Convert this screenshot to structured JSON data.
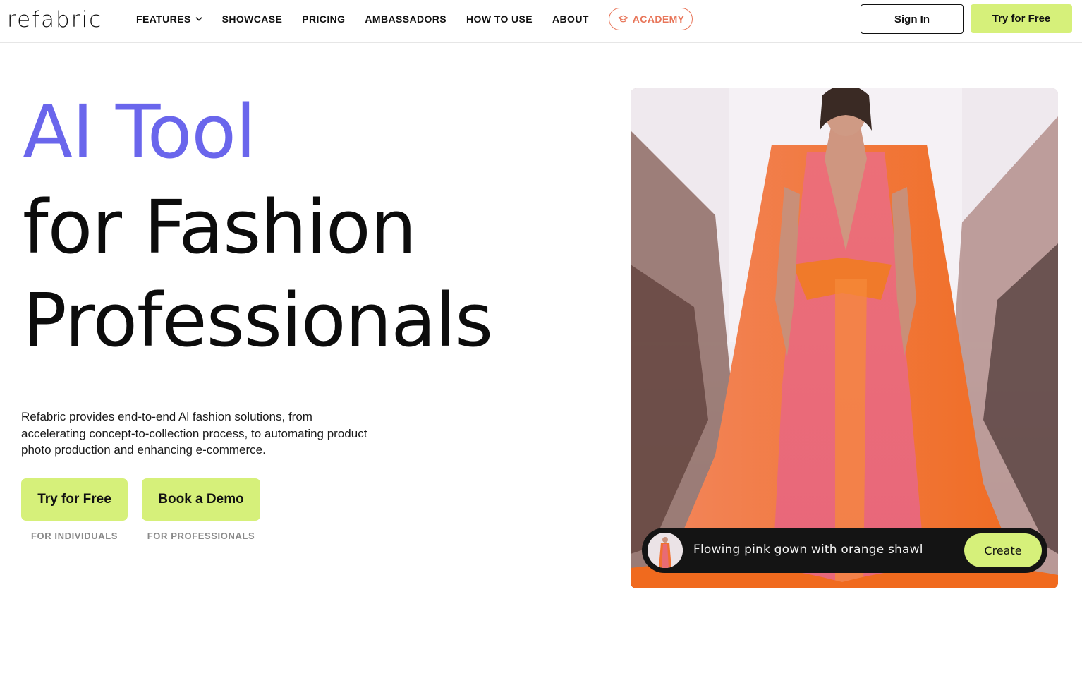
{
  "brand": {
    "logo_text": "refabric"
  },
  "nav": {
    "items": [
      {
        "label": "FEATURES",
        "has_dropdown": true
      },
      {
        "label": "SHOWCASE"
      },
      {
        "label": "PRICING"
      },
      {
        "label": "AMBASSADORS"
      },
      {
        "label": "HOW TO USE"
      },
      {
        "label": "ABOUT"
      }
    ],
    "academy_label": "ACADEMY",
    "sign_in_label": "Sign In",
    "try_label": "Try for Free"
  },
  "hero": {
    "line1": "AI Tool",
    "line2": "for Fashion",
    "line3": "Professionals",
    "description": "Refabric provides end-to-end Al fashion solutions, from accelerating concept-to-collection process, to automating product photo production and enhancing e-commerce.",
    "cta_primary": "Try for Free",
    "cta_primary_sub": "FOR INDIVIDUALS",
    "cta_secondary": "Book a Demo",
    "cta_secondary_sub": "FOR PROFESSIONALS"
  },
  "prompt_bar": {
    "text": "Flowing pink gown with orange shawl",
    "button": "Create"
  },
  "colors": {
    "accent_purple": "#6a66ec",
    "accent_lime": "#d6f07a",
    "academy_orange": "#e8765a",
    "prompt_bg": "#141414"
  },
  "icons": {
    "features_dropdown": "chevron-down-icon",
    "academy": "graduation-cap-icon"
  }
}
